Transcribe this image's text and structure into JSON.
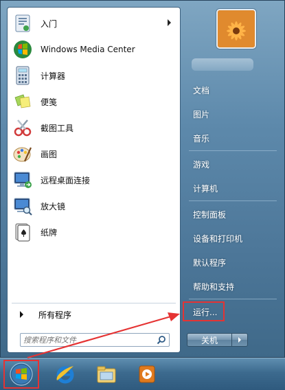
{
  "start_menu": {
    "programs": [
      {
        "label": "入门",
        "icon": "getting-started-icon",
        "has_submenu": true
      },
      {
        "label": "Windows Media Center",
        "icon": "media-center-icon",
        "has_submenu": false
      },
      {
        "label": "计算器",
        "icon": "calculator-icon",
        "has_submenu": false
      },
      {
        "label": "便笺",
        "icon": "sticky-notes-icon",
        "has_submenu": false
      },
      {
        "label": "截图工具",
        "icon": "snipping-tool-icon",
        "has_submenu": false
      },
      {
        "label": "画图",
        "icon": "paint-icon",
        "has_submenu": false
      },
      {
        "label": "远程桌面连接",
        "icon": "remote-desktop-icon",
        "has_submenu": false
      },
      {
        "label": "放大镜",
        "icon": "magnifier-icon",
        "has_submenu": false
      },
      {
        "label": "纸牌",
        "icon": "solitaire-icon",
        "has_submenu": false
      }
    ],
    "all_programs_label": "所有程序",
    "search_placeholder": "搜索程序和文件",
    "right_links": [
      "文档",
      "图片",
      "音乐",
      "游戏",
      "计算机",
      "控制面板",
      "设备和打印机",
      "默认程序",
      "帮助和支持",
      "运行..."
    ],
    "shutdown_label": "关机"
  },
  "taskbar": {
    "items": [
      "start-orb-icon",
      "internet-explorer-icon",
      "windows-explorer-icon",
      "media-player-icon"
    ]
  },
  "colors": {
    "highlight": "#e53333",
    "frame": "#5d89ab",
    "taskbar": "#3c6a8e"
  }
}
